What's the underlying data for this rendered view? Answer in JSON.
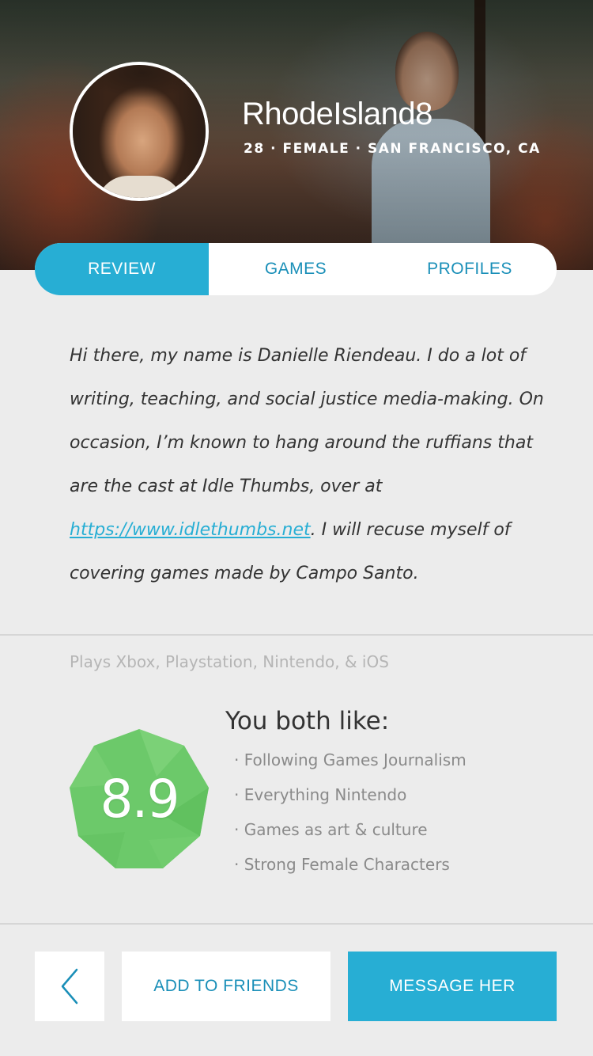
{
  "profile": {
    "username": "RhodeIsland8",
    "meta": "28 · FEMALE · SAN FRANCISCO, CA"
  },
  "tabs": [
    {
      "label": "REVIEW",
      "active": true
    },
    {
      "label": "GAMES",
      "active": false
    },
    {
      "label": "PROFILES",
      "active": false
    }
  ],
  "bio": {
    "text_before_link": "Hi there, my name is Danielle Riendeau. I do a lot of writing, teaching, and social justice media-making. On occasion, I’m known to hang around the ruffians that are the cast at Idle Thumbs, over at ",
    "link_text": "https://www.idlethumbs.net",
    "text_after_link": ". I will recuse myself of covering games made by Campo Santo."
  },
  "plays": "Plays Xbox, Playstation, Nintendo, & iOS",
  "match": {
    "score": "8.9",
    "likes_title": "You both like:",
    "likes": [
      "· Following Games Journalism",
      "· Everything Nintendo",
      "· Games as art & culture",
      "· Strong Female Characters"
    ]
  },
  "actions": {
    "back_icon": "chevron-left-icon",
    "add_friends": "ADD TO FRIENDS",
    "message": "MESSAGE HER"
  },
  "colors": {
    "accent": "#27aed4",
    "score_green": "#6cc96a"
  }
}
